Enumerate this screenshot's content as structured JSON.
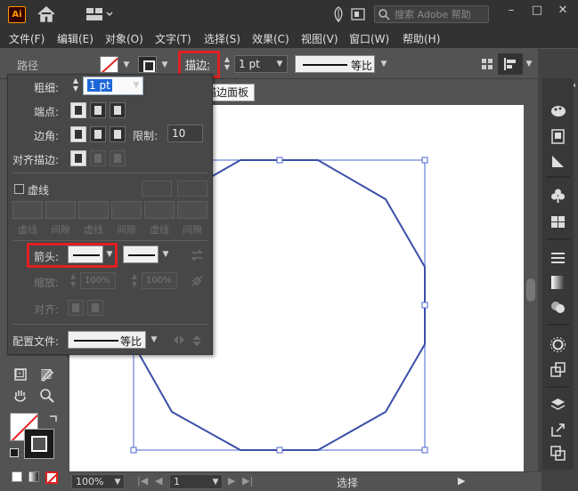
{
  "app": {
    "logo_text": "Ai"
  },
  "titlebar": {
    "search_placeholder": "搜索 Adobe 帮助",
    "minimize": "–",
    "maximize": "□",
    "close": "✕"
  },
  "menubar": {
    "items": [
      "文件(F)",
      "编辑(E)",
      "对象(O)",
      "文字(T)",
      "选择(S)",
      "效果(C)",
      "视图(V)",
      "窗口(W)",
      "帮助(H)"
    ]
  },
  "controlbar": {
    "selection_label": "路径",
    "stroke_link": "描边",
    "stroke_link_colon": ":",
    "stroke_weight": "1 pt",
    "profile_label": "等比"
  },
  "tooltip": {
    "text": "描边面板"
  },
  "stroke_panel": {
    "weight_label": "粗细",
    "weight_value": "1 pt",
    "cap_label": "端点",
    "corner_label": "边角",
    "limit_label": "限制",
    "limit_value": "10",
    "align_label": "对齐描边",
    "dashed_label": "虚线",
    "dash_labels": [
      "虚线",
      "间隙",
      "虚线",
      "间隙",
      "虚线",
      "间隙"
    ],
    "arrow_label": "箭头",
    "scale_label": "缩放",
    "scale_start": "100%",
    "scale_end": "100%",
    "align_arrow_label": "对齐",
    "profile_label": "配置文件",
    "profile_value": "等比"
  },
  "statusbar": {
    "zoom": "100%",
    "page": "1",
    "status_text": "选择"
  },
  "colors": {
    "accent_red": "#e02020",
    "path_blue": "#3a4fa8"
  },
  "icons": [
    "home-icon",
    "layout-icon",
    "search-icon",
    "hand-icon",
    "zoom-icon",
    "pen-icon",
    "swap-icon",
    "paintbrush-icon",
    "club-icon"
  ]
}
